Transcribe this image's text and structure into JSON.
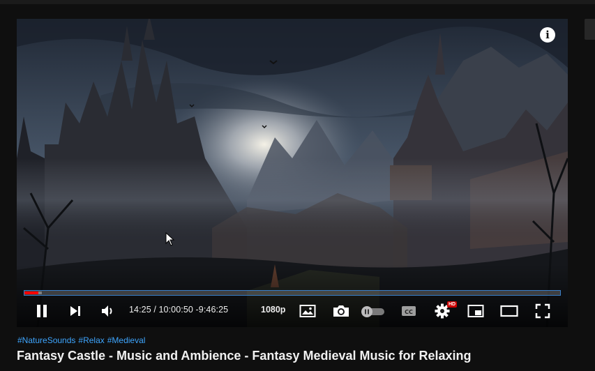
{
  "player": {
    "time_display": "14:25 / 10:00:50 -9:46:25",
    "quality_label": "1080p",
    "hd_badge": "HD",
    "info_label": "i",
    "progress": {
      "played_fraction": 0.026,
      "buffered_fraction": 0.006
    }
  },
  "icons": {
    "info": "info-icon",
    "play_pause": "pause-icon",
    "next": "next-icon",
    "volume": "volume-icon",
    "miniplayer_image": "image-icon",
    "screenshot": "camera-icon",
    "autoplay_toggle": "autoplay-toggle-icon",
    "captions": "cc-icon",
    "settings": "gear-icon",
    "miniplayer": "miniplayer-icon",
    "theater": "theater-icon",
    "fullscreen": "fullscreen-icon"
  },
  "colors": {
    "progress_played": "#ff0000",
    "progress_border": "#3a80c9",
    "hashtag": "#3ea6ff",
    "hd_badge": "#cc0000",
    "background": "#0f0f0f"
  },
  "video": {
    "hashtags": [
      "#NatureSounds",
      "#Relax",
      "#Medieval"
    ],
    "title": "Fantasy Castle - Music and Ambience - Fantasy Medieval Music for Relaxing"
  }
}
